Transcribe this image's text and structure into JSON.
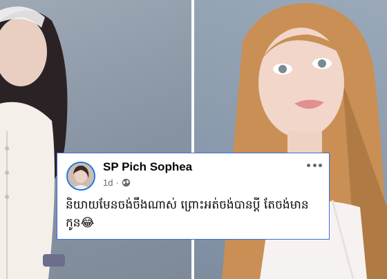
{
  "post": {
    "author": "SP Pich Sophea",
    "time": "1d",
    "separator": "·",
    "privacy_icon": "globe-icon",
    "more_icon": "more-options-icon",
    "text": "និយាយមែនចង់ចឹងណាស់ ព្រោះអត់ចង់បានប្ដី តែចង់មានកូន😂"
  },
  "colors": {
    "card_border": "#3a6fd8",
    "avatar_ring": "#1877f2",
    "meta_text": "#65676b",
    "body_text": "#050505",
    "photo_background": "#8a9aac"
  }
}
